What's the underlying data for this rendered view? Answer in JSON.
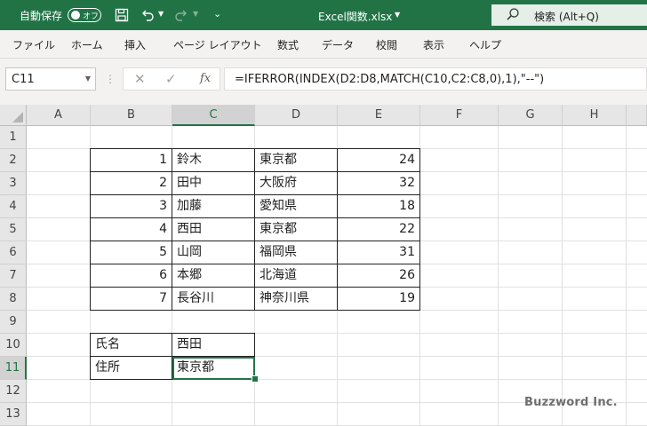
{
  "titlebar": {
    "autosave_label": "自動保存",
    "autosave_state": "オフ",
    "filename": "Excel関数.xlsx",
    "search_text": "検索 (Alt+Q)",
    "bg_color": "#217346"
  },
  "menu": {
    "items": [
      "ファイル",
      "ホーム",
      "挿入",
      "ページ レイアウト",
      "数式",
      "データ",
      "校閲",
      "表示",
      "ヘルプ"
    ]
  },
  "formula_bar": {
    "name_box": "C11",
    "fx_label": "fx",
    "formula": "=IFERROR(INDEX(D2:D8,MATCH(C10,C2:C8,0),1),\"--\")"
  },
  "sheet": {
    "columns": [
      "A",
      "B",
      "C",
      "D",
      "E",
      "F",
      "G",
      "H"
    ],
    "rows": [
      "1",
      "2",
      "3",
      "4",
      "5",
      "6",
      "7",
      "8",
      "9",
      "10",
      "11",
      "12",
      "13"
    ],
    "selected_column": "C",
    "selected_row": "11",
    "table": [
      {
        "b": "1",
        "c": "鈴木",
        "d": "東京都",
        "e": "24"
      },
      {
        "b": "2",
        "c": "田中",
        "d": "大阪府",
        "e": "32"
      },
      {
        "b": "3",
        "c": "加藤",
        "d": "愛知県",
        "e": "18"
      },
      {
        "b": "4",
        "c": "西田",
        "d": "東京都",
        "e": "22"
      },
      {
        "b": "5",
        "c": "山岡",
        "d": "福岡県",
        "e": "31"
      },
      {
        "b": "6",
        "c": "本郷",
        "d": "北海道",
        "e": "26"
      },
      {
        "b": "7",
        "c": "長谷川",
        "d": "神奈川県",
        "e": "19"
      }
    ],
    "lookup": [
      {
        "label": "氏名",
        "value": "西田"
      },
      {
        "label": "住所",
        "value": "東京都"
      }
    ]
  },
  "watermark": "Buzzword Inc."
}
